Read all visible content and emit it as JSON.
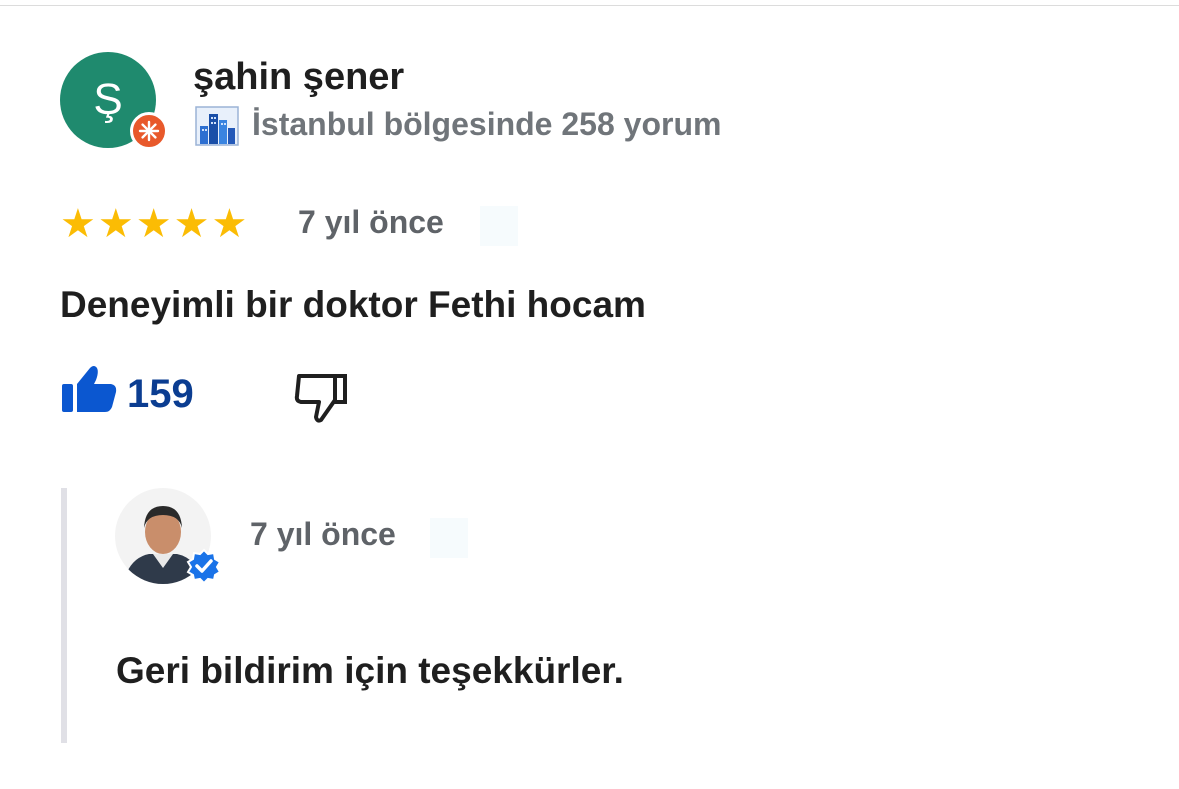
{
  "reviewer": {
    "initial": "Ş",
    "avatar_color": "#1f8a6e",
    "badge_color": "#e8592b",
    "name": "şahin şener",
    "meta": "İstanbul bölgesinde 258 yorum",
    "city_icon": "city-buildings-icon"
  },
  "review": {
    "rating": 5,
    "star_color": "#fbbc04",
    "time": "7 yıl önce",
    "text": "Deneyimli bir doktor Fethi hocam",
    "likes": "159",
    "like_color": "#0b57d0",
    "like_count_color": "#0b3d91"
  },
  "reply": {
    "time": "7 yıl önce",
    "text": "Geri bildirim için teşekkürler.",
    "verified_color": "#1a73e8"
  }
}
